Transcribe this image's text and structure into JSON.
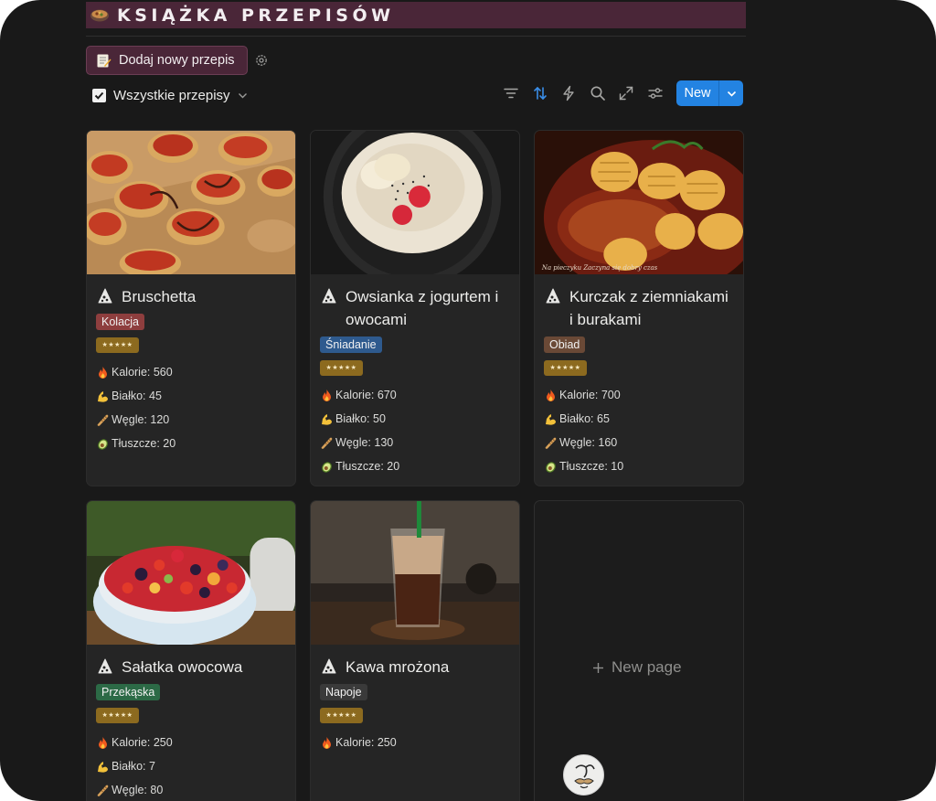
{
  "header": {
    "title": "KSIĄŻKA PRZEPISÓW",
    "add_button": "Dodaj nowy przepis"
  },
  "view": {
    "label": "Wszystkie przepisy"
  },
  "toolbar": {
    "icons": [
      "filter-icon",
      "sort-icon",
      "automation-icon",
      "search-icon",
      "expand-icon",
      "settings-sliders-icon"
    ],
    "new_label": "New"
  },
  "colors": {
    "banner": "#4a2638",
    "accent_blue": "#2383e2",
    "tag_kolacja": "#8e3e3e",
    "tag_sniadanie": "#2e5a8e",
    "tag_obiad": "#6a4936",
    "tag_przekaska": "#2c6a46",
    "tag_napoje": "#3a3a3a"
  },
  "recipes": [
    {
      "title": "Bruschetta",
      "tag": "Kolacja",
      "stars": "★★★★★",
      "kalorie": "Kalorie: 560",
      "bialko": "Białko: 45",
      "wegle": "Węgle: 120",
      "tluszcze": "Tłuszcze: 20"
    },
    {
      "title": "Owsianka z jogurtem i owocami",
      "tag": "Śniadanie",
      "stars": "★★★★★",
      "kalorie": "Kalorie: 670",
      "bialko": "Białko: 50",
      "wegle": "Węgle: 130",
      "tluszcze": "Tłuszcze: 20"
    },
    {
      "title": "Kurczak z ziemniakami i burakami",
      "tag": "Obiad",
      "stars": "★★★★★",
      "kalorie": "Kalorie: 700",
      "bialko": "Białko: 65",
      "wegle": "Węgle: 160",
      "tluszcze": "Tłuszcze: 10",
      "watermark": "Na pieczyku Zaczyna się dobry czas"
    },
    {
      "title": "Sałatka owocowa",
      "tag": "Przekąska",
      "stars": "★★★★★",
      "kalorie": "Kalorie: 250",
      "bialko": "Białko: 7",
      "wegle": "Węgle: 80"
    },
    {
      "title": "Kawa mrożona",
      "tag": "Napoje",
      "stars": "★★★★★",
      "kalorie": "Kalorie: 250"
    }
  ],
  "new_page": {
    "label": "New page"
  }
}
